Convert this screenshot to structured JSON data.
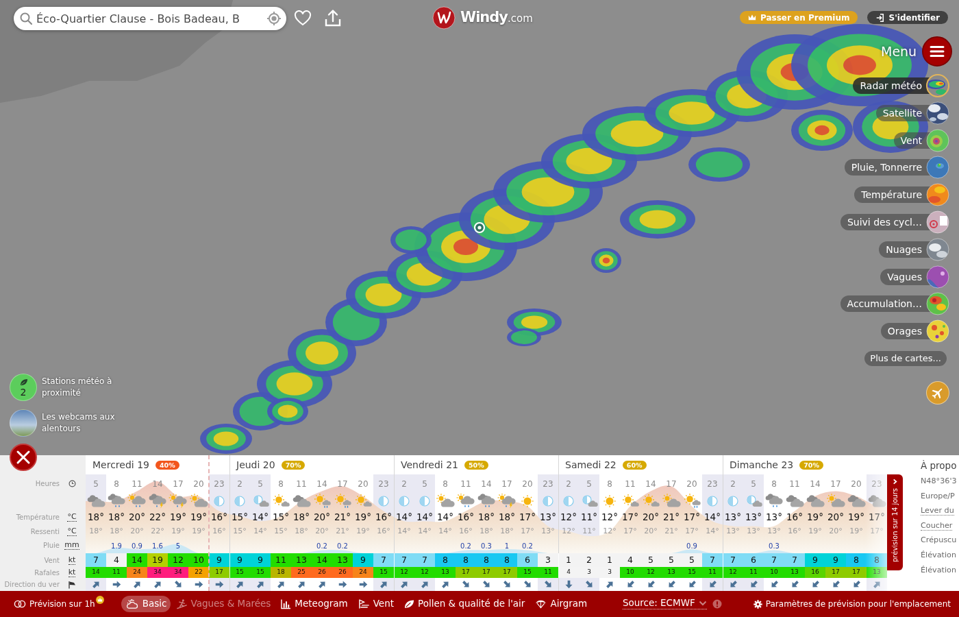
{
  "search": {
    "value": "Éco-Quartier Clause - Bois Badeau, B"
  },
  "logo": {
    "name": "Windy",
    "suffix": ".com"
  },
  "account": [
    {
      "kind": "premium",
      "label": "Passer en Premium"
    },
    {
      "kind": "login",
      "label": "S'identifier"
    }
  ],
  "menu": {
    "label": "Menu"
  },
  "layers": [
    {
      "kind": "radar",
      "label": "Radar météo",
      "selected": true
    },
    {
      "kind": "satellite",
      "label": "Satellite",
      "selected": false
    },
    {
      "kind": "wind",
      "label": "Vent",
      "selected": false
    },
    {
      "kind": "rain",
      "label": "Pluie, Tonnerre",
      "selected": false
    },
    {
      "kind": "temperature",
      "label": "Température",
      "selected": false
    },
    {
      "kind": "cyclones",
      "label": "Suivi des cycl…",
      "selected": false
    },
    {
      "kind": "clouds",
      "label": "Nuages",
      "selected": false
    },
    {
      "kind": "waves",
      "label": "Vagues",
      "selected": false
    },
    {
      "kind": "accumulation",
      "label": "Accumulation…",
      "selected": false
    },
    {
      "kind": "storms",
      "label": "Orages",
      "selected": false
    }
  ],
  "more_maps": {
    "label": "Plus de cartes..."
  },
  "nearby": [
    {
      "kind": "stations",
      "count": "2",
      "label": "Stations météo à proximité"
    },
    {
      "kind": "webcams",
      "label": "Les webcams aux alentours"
    }
  ],
  "forecast": {
    "rows": [
      {
        "kind": "hour",
        "label": "Heures"
      },
      {
        "kind": "sky"
      },
      {
        "kind": "temp",
        "label": "Température",
        "unit": "°C"
      },
      {
        "kind": "feel",
        "label": "Ressenti",
        "unit": "°C"
      },
      {
        "kind": "rain",
        "label": "Pluie",
        "unit": "mm"
      },
      {
        "kind": "wind",
        "label": "Vent",
        "unit": "kt"
      },
      {
        "kind": "gust",
        "label": "Rafales",
        "unit": "kt"
      },
      {
        "kind": "dir",
        "label": "Direction du ver"
      }
    ],
    "days": [
      {
        "label": "Mercredi 19",
        "chance": "40%",
        "color": "#f2561d",
        "hours": [
          {
            "hour": "5",
            "night": true,
            "now": false,
            "sky": {
              "kind": "cloudy"
            },
            "temp": "18°",
            "feel": "18°",
            "wind": "7",
            "gust": "14",
            "arrow": {
              "kind": "NE"
            }
          },
          {
            "hour": "8",
            "night": false,
            "now": false,
            "sky": {
              "kind": "rain"
            },
            "temp": "18°",
            "feel": "18°",
            "rain": "1.9",
            "wind": "4",
            "gust": "11",
            "arrow": {
              "kind": "E"
            }
          },
          {
            "hour": "11",
            "night": false,
            "now": false,
            "sky": {
              "kind": "sun-rain"
            },
            "temp": "20°",
            "feel": "20°",
            "rain": "0.9",
            "wind": "14",
            "gust": "24",
            "arrow": {
              "kind": "NE"
            }
          },
          {
            "hour": "14",
            "night": false,
            "now": false,
            "sky": {
              "kind": "storm"
            },
            "temp": "22°",
            "feel": "22°",
            "rain": "1.6",
            "wind": "19",
            "gust": "34",
            "arrow": {
              "kind": "NE"
            }
          },
          {
            "hour": "17",
            "night": false,
            "now": false,
            "sky": {
              "kind": "sun-storm"
            },
            "temp": "19°",
            "feel": "19°",
            "rain": "5",
            "wind": "12",
            "gust": "34",
            "arrow": {
              "kind": "SE"
            }
          },
          {
            "hour": "20",
            "night": false,
            "now": false,
            "sky": {
              "kind": "partly-cloudy"
            },
            "temp": "19°",
            "feel": "19°",
            "wind": "10",
            "gust": "22",
            "arrow": {
              "kind": "E"
            }
          },
          {
            "hour": "23",
            "night": true,
            "now": true,
            "sky": {
              "kind": "night"
            },
            "temp": "16°",
            "feel": "16°",
            "wind": "9",
            "gust": "17",
            "arrow": {
              "kind": "E"
            }
          }
        ]
      },
      {
        "label": "Jeudi 20",
        "chance": "70%",
        "color": "#d6a900",
        "hours": [
          {
            "hour": "2",
            "night": true,
            "now": false,
            "sky": {
              "kind": "night"
            },
            "temp": "15°",
            "feel": "15°",
            "wind": "9",
            "gust": "15",
            "arrow": {
              "kind": "NE"
            }
          },
          {
            "hour": "5",
            "night": true,
            "now": false,
            "sky": {
              "kind": "night-cloudy"
            },
            "temp": "14°",
            "feel": "14°",
            "wind": "9",
            "gust": "15",
            "arrow": {
              "kind": "NE"
            }
          },
          {
            "hour": "8",
            "night": false,
            "now": false,
            "sky": {
              "kind": "mostly-sunny"
            },
            "temp": "15°",
            "feel": "15°",
            "wind": "11",
            "gust": "18",
            "arrow": {
              "kind": "NE"
            }
          },
          {
            "hour": "11",
            "night": false,
            "now": false,
            "sky": {
              "kind": "cloudy"
            },
            "temp": "18°",
            "feel": "18°",
            "wind": "13",
            "gust": "25",
            "arrow": {
              "kind": "NE"
            }
          },
          {
            "hour": "14",
            "night": false,
            "now": false,
            "sky": {
              "kind": "sun-shower"
            },
            "temp": "20°",
            "feel": "20°",
            "rain": "0.2",
            "wind": "14",
            "gust": "26",
            "arrow": {
              "kind": "NE"
            }
          },
          {
            "hour": "17",
            "night": false,
            "now": false,
            "sky": {
              "kind": "sun-shower"
            },
            "temp": "21°",
            "feel": "21°",
            "rain": "0.2",
            "wind": "13",
            "gust": "26",
            "arrow": {
              "kind": "E"
            }
          },
          {
            "hour": "20",
            "night": false,
            "now": false,
            "sky": {
              "kind": "mostly-sunny"
            },
            "temp": "19°",
            "feel": "19°",
            "wind": "9",
            "gust": "24",
            "arrow": {
              "kind": "E"
            }
          },
          {
            "hour": "23",
            "night": true,
            "now": false,
            "sky": {
              "kind": "night"
            },
            "temp": "16°",
            "feel": "16°",
            "wind": "7",
            "gust": "15",
            "arrow": {
              "kind": "NE"
            }
          }
        ]
      },
      {
        "label": "Vendredi 21",
        "chance": "50%",
        "color": "#d6a900",
        "hours": [
          {
            "hour": "2",
            "night": true,
            "now": false,
            "sky": {
              "kind": "night"
            },
            "temp": "14°",
            "feel": "14°",
            "wind": "7",
            "gust": "12",
            "arrow": {
              "kind": "NE"
            }
          },
          {
            "hour": "5",
            "night": true,
            "now": false,
            "sky": {
              "kind": "night"
            },
            "temp": "14°",
            "feel": "14°",
            "wind": "7",
            "gust": "12",
            "arrow": {
              "kind": "NE"
            }
          },
          {
            "hour": "8",
            "night": false,
            "now": false,
            "sky": {
              "kind": "partly-cloudy"
            },
            "temp": "14°",
            "feel": "14°",
            "wind": "8",
            "gust": "13",
            "arrow": {
              "kind": "NE"
            }
          },
          {
            "hour": "11",
            "night": false,
            "now": false,
            "sky": {
              "kind": "sun-rain"
            },
            "temp": "16°",
            "feel": "16°",
            "rain": "0.2",
            "wind": "8",
            "gust": "17",
            "arrow": {
              "kind": "SE"
            }
          },
          {
            "hour": "14",
            "night": false,
            "now": false,
            "sky": {
              "kind": "rain"
            },
            "temp": "18°",
            "feel": "18°",
            "rain": "0.3",
            "wind": "8",
            "gust": "17",
            "arrow": {
              "kind": "SE"
            }
          },
          {
            "hour": "17",
            "night": false,
            "now": false,
            "sky": {
              "kind": "sun-storm"
            },
            "temp": "18°",
            "feel": "18°",
            "rain": "1",
            "wind": "8",
            "gust": "17",
            "arrow": {
              "kind": "SE"
            }
          },
          {
            "hour": "20",
            "night": false,
            "now": false,
            "sky": {
              "kind": "sunny"
            },
            "temp": "17°",
            "feel": "17°",
            "rain": "0.2",
            "wind": "6",
            "gust": "15",
            "arrow": {
              "kind": "SE"
            }
          },
          {
            "hour": "23",
            "night": true,
            "now": false,
            "sky": {
              "kind": "night"
            },
            "temp": "13°",
            "feel": "13°",
            "wind": "3",
            "gust": "11",
            "arrow": {
              "kind": "SE"
            }
          }
        ]
      },
      {
        "label": "Samedi 22",
        "chance": "60%",
        "color": "#d6a900",
        "hours": [
          {
            "hour": "2",
            "night": true,
            "now": false,
            "sky": {
              "kind": "night"
            },
            "temp": "12°",
            "feel": "12°",
            "wind": "1",
            "gust": "4",
            "arrow": {
              "kind": "S"
            }
          },
          {
            "hour": "5",
            "night": true,
            "now": false,
            "sky": {
              "kind": "night-cloudy"
            },
            "temp": "11°",
            "feel": "11°",
            "wind": "2",
            "gust": "3",
            "arrow": {
              "kind": "SE"
            }
          },
          {
            "hour": "8",
            "night": false,
            "now": false,
            "sky": {
              "kind": "sunny"
            },
            "temp": "12°",
            "feel": "12°",
            "wind": "1",
            "gust": "3",
            "arrow": {
              "kind": "NE"
            }
          },
          {
            "hour": "11",
            "night": false,
            "now": false,
            "sky": {
              "kind": "mostly-sunny"
            },
            "temp": "17°",
            "feel": "17°",
            "wind": "4",
            "gust": "10",
            "arrow": {
              "kind": "SW"
            }
          },
          {
            "hour": "14",
            "night": false,
            "now": false,
            "sky": {
              "kind": "mostly-sunny"
            },
            "temp": "20°",
            "feel": "20°",
            "wind": "5",
            "gust": "12",
            "arrow": {
              "kind": "SW"
            }
          },
          {
            "hour": "17",
            "night": false,
            "now": false,
            "sky": {
              "kind": "partly-cloudy"
            },
            "temp": "21°",
            "feel": "21°",
            "wind": "5",
            "gust": "13",
            "arrow": {
              "kind": "SW"
            }
          },
          {
            "hour": "20",
            "night": false,
            "now": false,
            "sky": {
              "kind": "sun-shower"
            },
            "temp": "17°",
            "feel": "17°",
            "rain": "0.9",
            "wind": "5",
            "gust": "15",
            "arrow": {
              "kind": "SW"
            }
          },
          {
            "hour": "23",
            "night": true,
            "now": false,
            "sky": {
              "kind": "night"
            },
            "temp": "14°",
            "feel": "14°",
            "wind": "7",
            "gust": "11",
            "arrow": {
              "kind": "SW"
            }
          }
        ]
      },
      {
        "label": "Dimanche 23",
        "chance": "70%",
        "color": "#d6a900",
        "hours": [
          {
            "hour": "2",
            "night": true,
            "now": false,
            "sky": {
              "kind": "night"
            },
            "temp": "13°",
            "feel": "13°",
            "wind": "7",
            "gust": "12",
            "arrow": {
              "kind": "SW"
            }
          },
          {
            "hour": "5",
            "night": true,
            "now": false,
            "sky": {
              "kind": "night-cloudy"
            },
            "temp": "13°",
            "feel": "13°",
            "wind": "6",
            "gust": "11",
            "arrow": {
              "kind": "SW"
            }
          },
          {
            "hour": "8",
            "night": false,
            "now": false,
            "sky": {
              "kind": "rain"
            },
            "temp": "13°",
            "feel": "13°",
            "rain": "0.3",
            "wind": "7",
            "gust": "10",
            "arrow": {
              "kind": "SW"
            }
          },
          {
            "hour": "11",
            "night": false,
            "now": false,
            "sky": {
              "kind": "cloudy"
            },
            "temp": "16°",
            "feel": "16°",
            "wind": "7",
            "gust": "13",
            "arrow": {
              "kind": "SW"
            }
          },
          {
            "hour": "14",
            "night": false,
            "now": false,
            "sky": {
              "kind": "cloudy"
            },
            "temp": "19°",
            "feel": "19°",
            "wind": "9",
            "gust": "16",
            "arrow": {
              "kind": "SW"
            }
          },
          {
            "hour": "17",
            "night": false,
            "now": false,
            "sky": {
              "kind": "partly-cloudy"
            },
            "temp": "20°",
            "feel": "20°",
            "wind": "9",
            "gust": "17",
            "arrow": {
              "kind": "SW"
            }
          },
          {
            "hour": "20",
            "night": false,
            "now": false,
            "sky": {
              "kind": "cloudy"
            },
            "temp": "19°",
            "feel": "19°",
            "wind": "8",
            "gust": "17",
            "arrow": {
              "kind": "SW"
            }
          },
          {
            "hour": "23",
            "night": true,
            "now": false,
            "sky": {
              "kind": "cloudy"
            },
            "temp": "17°",
            "feel": "17°",
            "wind": "8",
            "gust": "13",
            "arrow": {
              "kind": "NE"
            }
          }
        ]
      }
    ]
  },
  "extended_tab": {
    "label": "prévision sur 14 jours"
  },
  "about": {
    "title": "À propo",
    "lines": [
      {
        "text": "N48°36'3",
        "link": false
      },
      {
        "text": "Europe/P",
        "link": false
      },
      {
        "text": "Lever du",
        "link": true
      },
      {
        "text": "Coucher",
        "link": true
      },
      {
        "text": "Crépuscu",
        "link": false
      },
      {
        "text": "Élévation",
        "link": false
      },
      {
        "text": "Élévation",
        "link": false
      }
    ]
  },
  "bottom_bar": {
    "hourly": {
      "label": "Prévision sur 1h",
      "premium": true
    },
    "tabs": [
      {
        "kind": "basic",
        "label": "Basic",
        "selected": true,
        "disabled": false
      },
      {
        "kind": "waves",
        "label": "Vagues & Marées",
        "selected": false,
        "disabled": true
      },
      {
        "kind": "meteogram",
        "label": "Meteogram",
        "selected": false,
        "disabled": false
      },
      {
        "kind": "wind",
        "label": "Vent",
        "selected": false,
        "disabled": false
      },
      {
        "kind": "pollen",
        "label": "Pollen & qualité de l'air",
        "selected": false,
        "disabled": false
      },
      {
        "kind": "airgram",
        "label": "Airgram",
        "selected": false,
        "disabled": false
      }
    ],
    "source": {
      "label": "Source: ECMWF"
    },
    "settings": {
      "label": "Paramètres de prévision pour l'emplacement"
    }
  }
}
